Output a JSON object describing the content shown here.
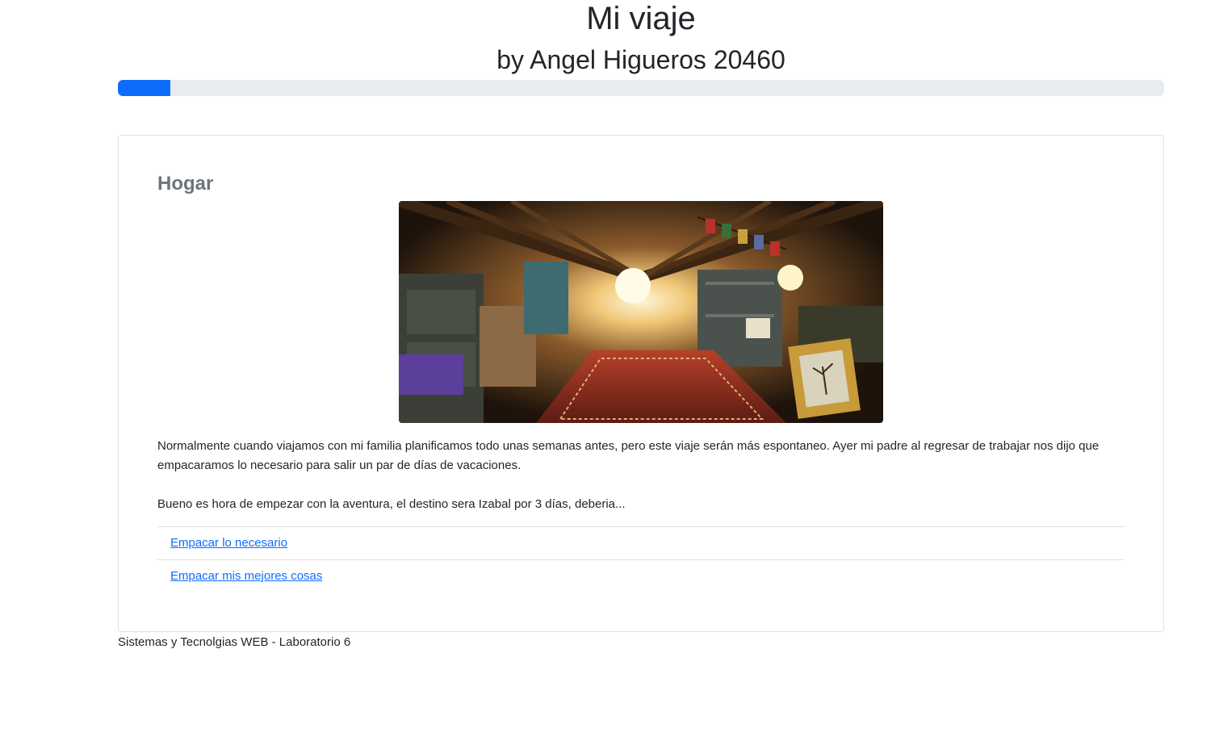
{
  "header": {
    "title": "Mi viaje",
    "subtitle": "by Angel Higueros 20460"
  },
  "progress": {
    "percent": 5,
    "fill_color": "#0d6efd",
    "track_color": "#e9ecef"
  },
  "scene": {
    "title": "Hogar",
    "image_icon": "attic-room-image",
    "paragraphs": [
      "Normalmente cuando viajamos con mi familia planificamos todo unas semanas antes, pero este viaje serán más espontaneo. Ayer mi padre al regresar de trabajar nos dijo que empacaramos lo necesario para salir un par de días de vacaciones.",
      "Bueno es hora de empezar con la aventura, el destino sera Izabal por 3 días, deberia..."
    ],
    "options": [
      {
        "label": "Empacar lo necesario"
      },
      {
        "label": "Empacar mis mejores cosas"
      }
    ]
  },
  "footer": {
    "text": "Sistemas y Tecnolgias WEB - Laboratorio 6"
  },
  "colors": {
    "link": "#0d6efd",
    "muted_heading": "#6c757d",
    "border": "#dee2e6"
  }
}
